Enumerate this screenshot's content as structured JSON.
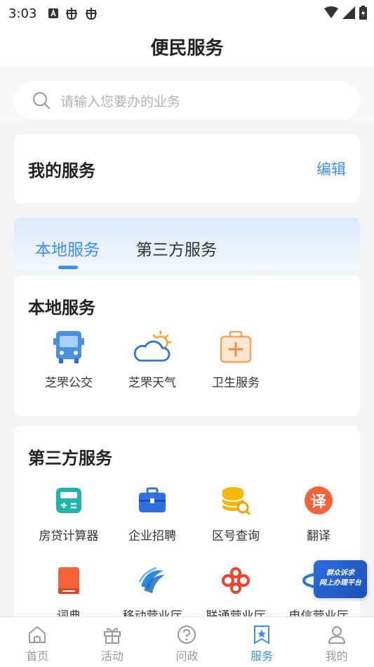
{
  "status": {
    "time": "3:03"
  },
  "header": {
    "title": "便民服务"
  },
  "search": {
    "placeholder": "请输入您要办的业务"
  },
  "my_service": {
    "title": "我的服务",
    "edit_label": "编辑"
  },
  "tabs": [
    {
      "label": "本地服务",
      "active": true
    },
    {
      "label": "第三方服务",
      "active": false
    }
  ],
  "local_section": {
    "title": "本地服务",
    "items": [
      {
        "label": "芝罘公交",
        "icon": "bus-icon"
      },
      {
        "label": "芝罘天气",
        "icon": "weather-icon"
      },
      {
        "label": "卫生服务",
        "icon": "medical-kit-icon"
      }
    ]
  },
  "third_section": {
    "title": "第三方服务",
    "items": [
      {
        "label": "房贷计算器",
        "icon": "calculator-icon"
      },
      {
        "label": "企业招聘",
        "icon": "briefcase-icon"
      },
      {
        "label": "区号查询",
        "icon": "database-search-icon"
      },
      {
        "label": "翻译",
        "icon": "translate-icon",
        "glyph": "译"
      },
      {
        "label": "词典",
        "icon": "book-icon"
      },
      {
        "label": "移动营业厅",
        "icon": "china-mobile-icon"
      },
      {
        "label": "联通营业厅",
        "icon": "china-unicom-icon"
      },
      {
        "label": "电信营业厅",
        "icon": "china-telecom-icon"
      }
    ]
  },
  "float_badge": {
    "line1": "群众诉求",
    "line2": "网上办理平台"
  },
  "tabbar": [
    {
      "label": "首页",
      "icon": "home-icon",
      "active": false
    },
    {
      "label": "活动",
      "icon": "gift-icon",
      "active": false
    },
    {
      "label": "问政",
      "icon": "question-icon",
      "active": false
    },
    {
      "label": "服务",
      "icon": "service-star-icon",
      "active": true
    },
    {
      "label": "我的",
      "icon": "user-icon",
      "active": false
    }
  ],
  "colors": {
    "accent": "#3d8ef0",
    "background": "#f3f4f6"
  }
}
